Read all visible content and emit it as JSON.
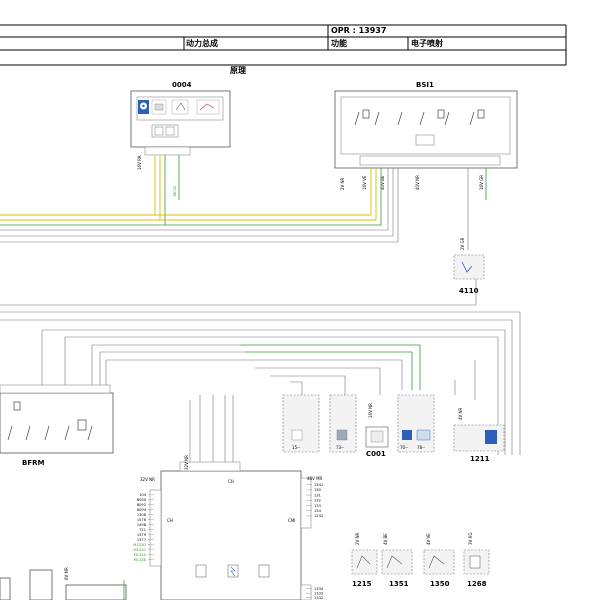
{
  "header": {
    "opr": "OPR : 13937",
    "category": "动力总成",
    "function_label": "功能",
    "function_value": "电子喷射",
    "section_title": "原理"
  },
  "components": {
    "c0004": "0004",
    "bsi1": "BSI1",
    "c4110": "4110",
    "bfrm": "BFRM",
    "c001": "C001",
    "c1211": "1211",
    "c1215": "1215",
    "c1351": "1351",
    "c1350": "1350",
    "c1268": "1268",
    "ecu_ch_top": "CH",
    "ecu_ch_left": "CH",
    "ecu_cmi": "CMI",
    "box15": "15--",
    "box73": "73--",
    "box70": "70--",
    "box78": "78--"
  },
  "connectors": {
    "c0004_conn": "16V RA",
    "bsi1_conn_a": "2V NR",
    "bsi1_conn_b": "16V VE",
    "bsi1_conn_c": "40V BE",
    "bsi1_conn_d": "40V NR",
    "bsi1_conn_e": "16V GR",
    "c4110_conn": "2V GR",
    "ecu_conn_a": "32V NR",
    "ecu_conn_b": "32V NR",
    "ecu_conn_c": "48V MR",
    "c1211_conn": "4V NR",
    "c1215_conn": "2V NR",
    "c1351_conn": "4V BE",
    "c1350_conn": "4V VE",
    "c1268_conn": "3V RG",
    "c001_conn": "16V NR",
    "left_conn": "6V MR"
  },
  "ecu_left_pins": [
    "104",
    "8090",
    "8092",
    "8094",
    "1306",
    "1576",
    "1498",
    "721",
    "1379",
    "1377",
    "M132D",
    "M132C",
    "M132A",
    "M132B"
  ],
  "ecu_right_pins": [
    "1341",
    "130",
    "131",
    "132",
    "133",
    "134",
    "1232"
  ],
  "ecu_bottom_pins": [
    "1334",
    "1333",
    "1332"
  ],
  "colors": {
    "line": "#555555",
    "green_wire": "#3a9a3a",
    "yellow_wire": "#d4c400",
    "blue_wire": "#2d5fb8",
    "panel_fill": "#f7f7f7",
    "box_fill": "#eeeeee"
  },
  "icons": [
    "gauge-icon",
    "battery-icon",
    "switch-icon",
    "relay-icon",
    "sensor-icon",
    "fuse-icon"
  ]
}
